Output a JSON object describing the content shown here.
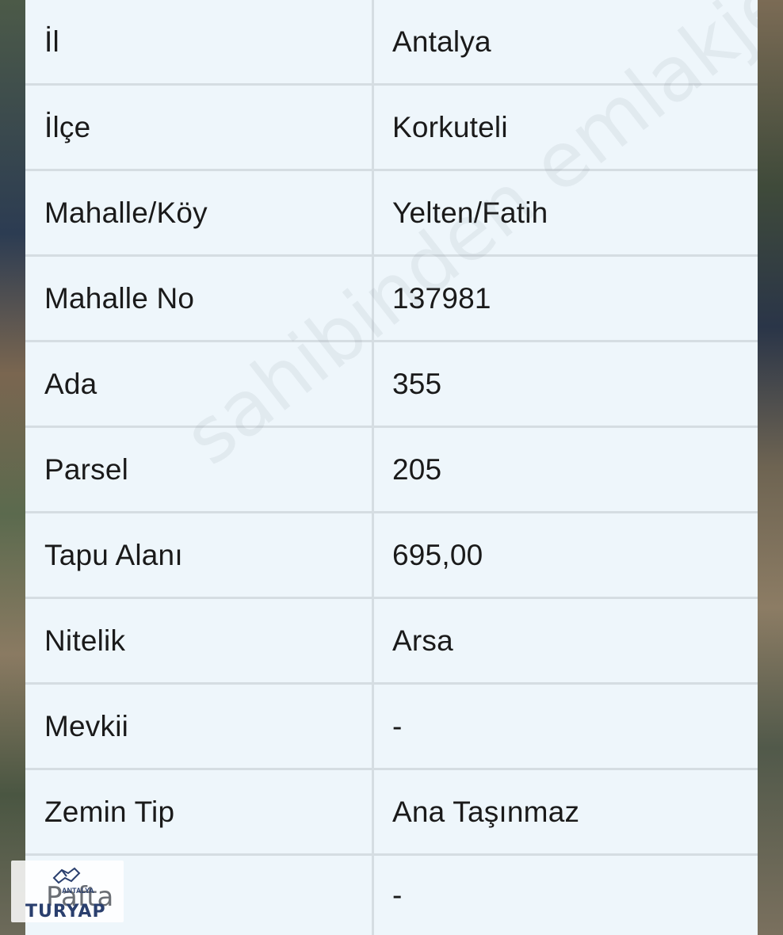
{
  "rows": [
    {
      "label": "İl",
      "value": "Antalya"
    },
    {
      "label": "İlçe",
      "value": "Korkuteli"
    },
    {
      "label": "Mahalle/Köy",
      "value": "Yelten/Fatih"
    },
    {
      "label": "Mahalle No",
      "value": "137981"
    },
    {
      "label": "Ada",
      "value": "355"
    },
    {
      "label": "Parsel",
      "value": "205"
    },
    {
      "label": "Tapu Alanı",
      "value": "695,00"
    },
    {
      "label": "Nitelik",
      "value": "Arsa"
    },
    {
      "label": "Mevkii",
      "value": "-"
    },
    {
      "label": "Zemin Tip",
      "value": "Ana Taşınmaz"
    },
    {
      "label": "",
      "value": "-"
    }
  ],
  "watermark": "sahibinden emlakjet.com",
  "logo": {
    "pafta": "Pafta",
    "antalya": "ANTALYA",
    "brand": "TURYAP"
  },
  "colors": {
    "panel_bg": "#eef6fb",
    "divider": "#d5dde2",
    "text": "#1a1a1a",
    "logo_brand": "#2a3f6e"
  }
}
